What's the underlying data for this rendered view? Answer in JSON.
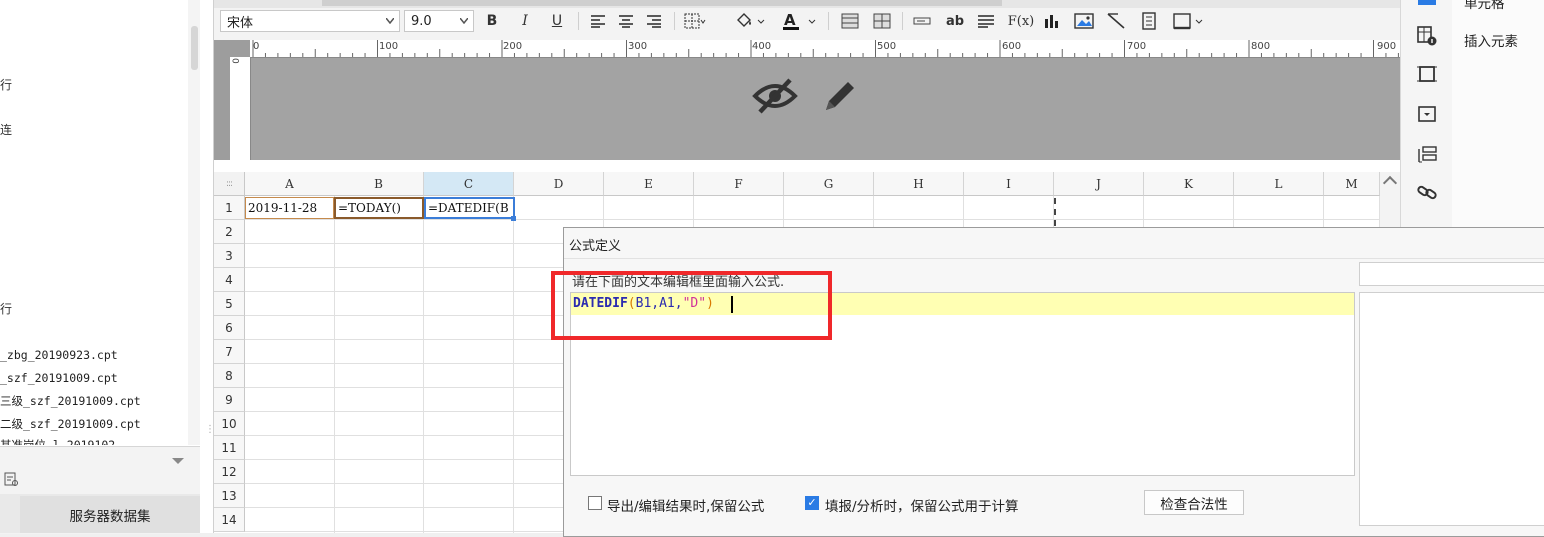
{
  "left_panel": {
    "tree_fragments": [
      "行",
      "连",
      "行"
    ],
    "files": [
      "_zbg_20190923.cpt",
      "_szf_20191009.cpt",
      "三级_szf_20191009.cpt",
      "二级_szf_20191009.cpt",
      "其准岗位   l   2019102"
    ],
    "server_dataset_tab": "服务器数据集"
  },
  "toolbar": {
    "font_name": "宋体",
    "font_size": "9.0",
    "bold": "B",
    "italic": "I",
    "underline": "U",
    "text_btn_ab": "ab",
    "formula_btn": "F(x)"
  },
  "ruler": {
    "labels": [
      "0",
      "100",
      "200",
      "300",
      "400",
      "500",
      "600",
      "700",
      "800",
      "900"
    ],
    "vertical_zero": "0"
  },
  "sheet": {
    "columns": [
      "A",
      "B",
      "C",
      "D",
      "E",
      "F",
      "G",
      "H",
      "I",
      "J",
      "K",
      "L",
      "M"
    ],
    "rows": [
      "1",
      "2",
      "3",
      "4",
      "5",
      "6",
      "7",
      "8",
      "9",
      "10",
      "11",
      "12",
      "13",
      "14"
    ],
    "cells": {
      "A1": "2019-11-28",
      "B1": "=TODAY()",
      "C1": "=DATEDIF(B"
    }
  },
  "right_panel": {
    "cell_tab": "单元格",
    "insert_element": "插入元素"
  },
  "dialog": {
    "title": "公式定义",
    "prompt": "请在下面的文本编辑框里面输入公式.",
    "formula": {
      "function": "DATEDIF",
      "open": "(",
      "args": "B1,A1,",
      "string": "\"D\"",
      "close": ")"
    },
    "option_export": "导出/编辑结果时,保留公式",
    "option_export_checked": false,
    "option_fill": "填报/分析时，保留公式用于计算",
    "option_fill_checked": true,
    "check_button": "检查合法性"
  },
  "colors": {
    "highlight_box": "#f0282a",
    "selected_cell": "#3b7dd8",
    "checkbox": "#2a7be4",
    "editor_line": "#ffffb3"
  }
}
